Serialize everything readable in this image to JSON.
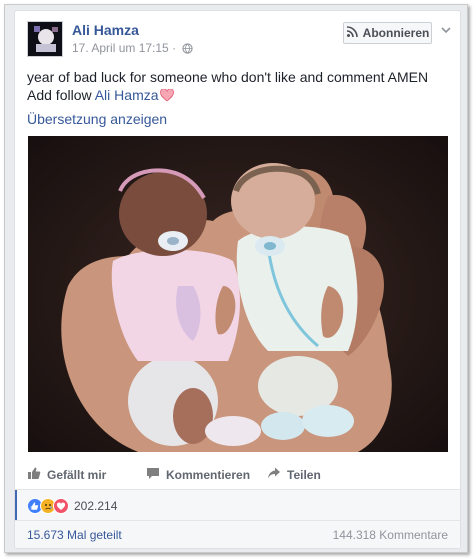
{
  "post": {
    "author": "Ali Hamza",
    "timestamp": "17. April um 17:15",
    "privacy_icon": "globe-icon",
    "subscribe_label": "Abonnieren",
    "text_line1": "year of bad luck for someone who don't like and comment AMEN",
    "text_line2_prefix": "Add follow ",
    "text_mention": "Ali Hamza",
    "translate_link": "Übersetzung anzeigen",
    "photo_description_icon": "photo-two-tiny-babies-in-hand"
  },
  "actions": {
    "like_label": "Gefällt mir",
    "comment_label": "Kommentieren",
    "share_label": "Teilen"
  },
  "stats": {
    "reaction_count": "202.214",
    "shares": "15.673 Mal geteilt",
    "comments": "144.318 Kommentare"
  },
  "colors": {
    "link_blue": "#365899",
    "like_blue": "#4080ff",
    "love_red": "#f25268",
    "sad_yellow": "#f7b125"
  }
}
